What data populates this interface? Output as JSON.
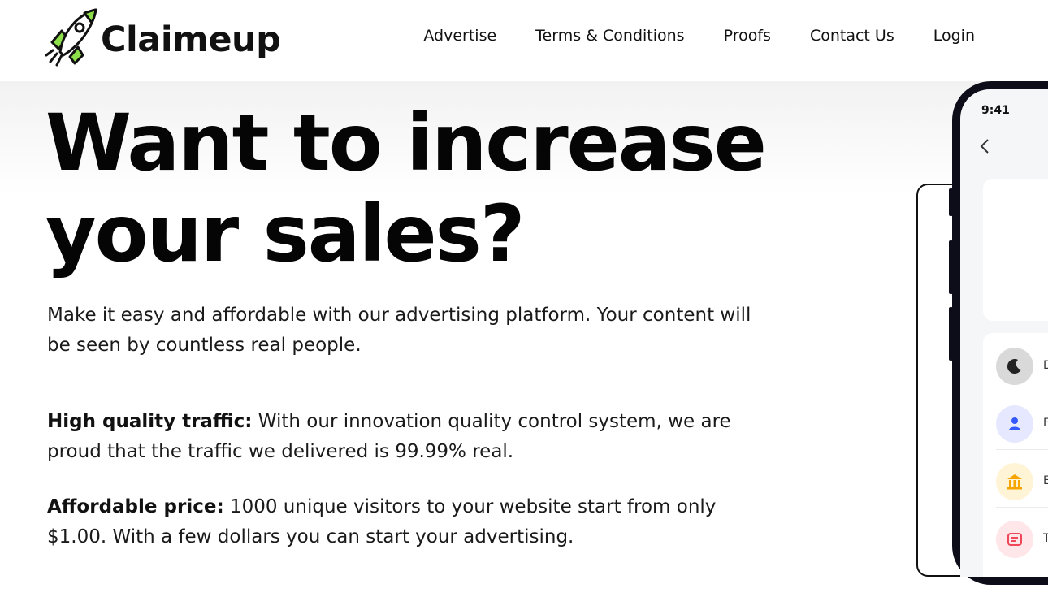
{
  "brand": {
    "name": "Claimeup"
  },
  "nav": {
    "items": [
      "Advertise",
      "Terms & Conditions",
      "Proofs",
      "Contact Us",
      "Login"
    ]
  },
  "hero": {
    "headline_line1": "Want to increase",
    "headline_line2": "your sales?",
    "lede": "Make it easy and affordable with our advertising platform. Your content will be seen by countless real people.",
    "features": [
      {
        "title": "High quality traffic:",
        "text": " With our innovation quality control system, we are proud that the traffic we delivered is 99.99% real."
      },
      {
        "title": "Affordable price:",
        "text": " 1000 unique visitors to your website start from only $1.00. With a few dollars you can start your advertising."
      }
    ]
  },
  "phone": {
    "time": "9:41",
    "rows": [
      {
        "icon": "moon-icon",
        "initial": "D",
        "bg": "#d9d9d9"
      },
      {
        "icon": "user-icon",
        "initial": "F",
        "bg": "#e6e8ff"
      },
      {
        "icon": "bank-icon",
        "initial": "E",
        "bg": "#fff4d6"
      },
      {
        "icon": "ticket-icon",
        "initial": "T",
        "bg": "#ffe6e8"
      }
    ]
  },
  "colors": {
    "brand_green": "#8ee04a",
    "text": "#111111",
    "phone_frame": "#0d0d1a",
    "user_blue": "#3358ff",
    "bank_orange": "#f5a400",
    "ticket_red": "#f0465a"
  }
}
